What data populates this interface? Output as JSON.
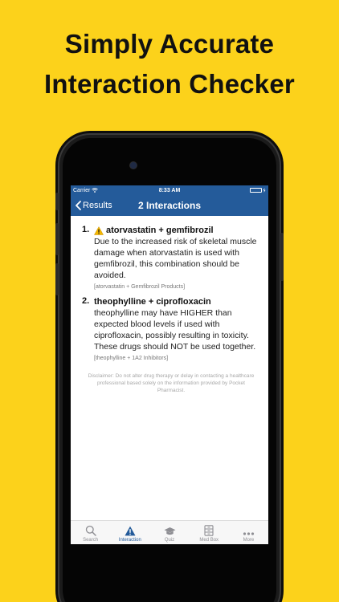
{
  "headline": {
    "line1": "Simply Accurate",
    "line2": "Interaction Checker"
  },
  "status_bar": {
    "carrier": "Carrier",
    "time": "8:33 AM",
    "battery_level": 1.0
  },
  "nav": {
    "back_label": "Results",
    "title": "2 Interactions"
  },
  "interactions": [
    {
      "number": "1.",
      "title": "atorvastatin + gemfibrozil",
      "warning_icon": "warning-icon",
      "description": "Due to the increased risk of skeletal muscle damage when atorvastatin is used with gemfibrozil, this combination should be avoided.",
      "source": "[atorvastatin + Gemfibrozil Products]"
    },
    {
      "number": "2.",
      "title": "theophylline + ciprofloxacin",
      "description": "theophylline may have HIGHER than expected blood levels if used with ciprofloxacin, possibly resulting in toxicity. These drugs should NOT be used together.",
      "source": "[theophylline + 1A2 Inhibitors]"
    }
  ],
  "disclaimer": "Disclaimer: Do not alter drug therapy or delay in contacting a healthcare professional based solely on the information provided by Pocket Pharmacist.",
  "tabs": [
    {
      "label": "Search",
      "icon": "search-icon",
      "active": false
    },
    {
      "label": "Interaction",
      "icon": "warning-icon",
      "active": true
    },
    {
      "label": "Quiz",
      "icon": "graduation-cap-icon",
      "active": false
    },
    {
      "label": "Med Box",
      "icon": "cabinet-icon",
      "active": false
    },
    {
      "label": "More",
      "icon": "more-icon",
      "active": false
    }
  ],
  "colors": {
    "background": "#fcd21b",
    "nav": "#245b9a",
    "warning": "#f5b800",
    "active_tab": "#245b9a"
  }
}
